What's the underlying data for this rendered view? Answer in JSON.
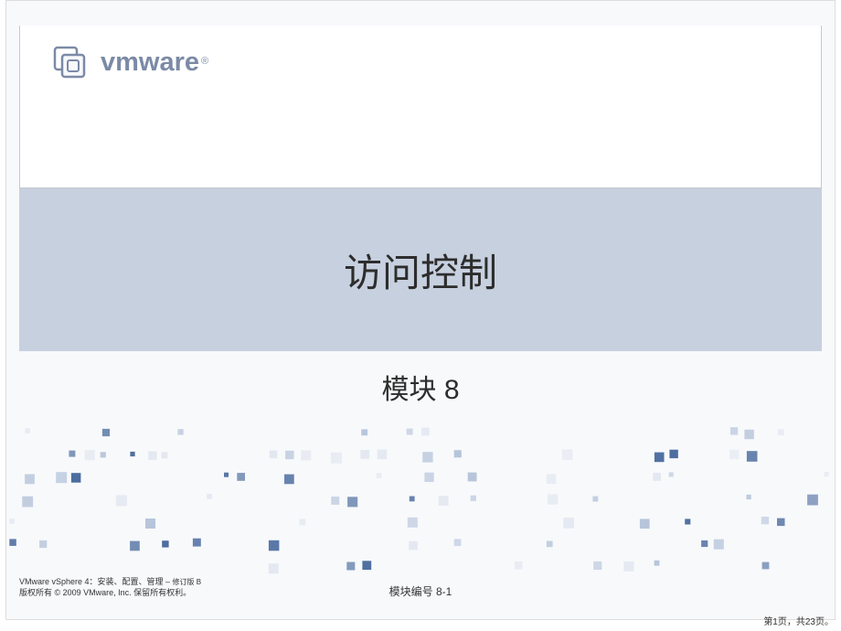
{
  "brand": {
    "name": "vmware",
    "trademark": "®"
  },
  "title": "访问控制",
  "subtitle": "模块 8",
  "footer": {
    "line1_prefix": "VMware vSphere 4：安装、配置、管理 – ",
    "line1_suffix": "修订版 B",
    "line2": "版权所有 © 2009 VMware, Inc. 保留所有权利。"
  },
  "module_number": "模块编号 8-1",
  "page_indicator": "第1页，共23页。",
  "colors": {
    "title_band": "#c7d0df",
    "logo": "#7b8aa6",
    "dot_blue": "#4a6b9e",
    "dot_light": "#b4c3da"
  }
}
